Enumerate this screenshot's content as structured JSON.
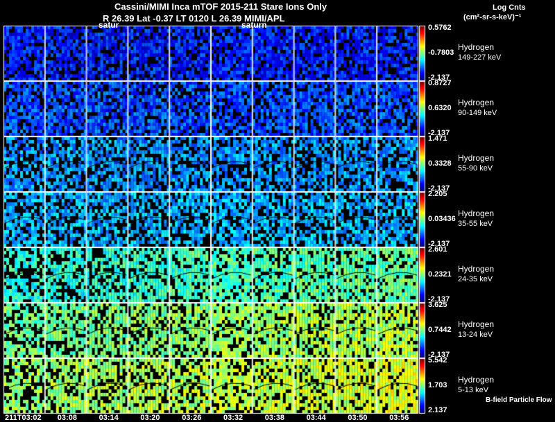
{
  "header": {
    "title": "Cassini/MIMI Inca mTOF  2015-211    Stare    Ions Only",
    "subtitle": "R          26.39 Lat -0.37 LT 0120 L          26.39  MIMI/APL",
    "markers": [
      "satur",
      "saturn"
    ],
    "units_line1": "Log Cnts",
    "units_line2": "(cm²-sr-s-keV)⁻¹"
  },
  "chart_data": {
    "type": "heatmap",
    "title": "Cassini/MIMI Inca mTOF 2015-211 Stare Ions Only",
    "x_tick_labels": [
      "211T03:02",
      "03:08",
      "03:14",
      "03:20",
      "03:26",
      "03:32",
      "03:38",
      "03:44",
      "03:50",
      "03:56"
    ],
    "rows": [
      {
        "species": "Hydrogen",
        "energy": "149-227 keV",
        "cbar_max": "0.5762",
        "cbar_mid": "-0.7803",
        "cbar_min": "-2.137",
        "level": 0.15
      },
      {
        "species": "Hydrogen",
        "energy": "90-149 keV",
        "cbar_max": "0.8727",
        "cbar_mid": "0.6320",
        "cbar_min": "-2.137",
        "level": 0.2
      },
      {
        "species": "Hydrogen",
        "energy": "55-90 keV",
        "cbar_max": "1.471",
        "cbar_mid": "0.3328",
        "cbar_min": "-2.137",
        "level": 0.27
      },
      {
        "species": "Hydrogen",
        "energy": "35-55 keV",
        "cbar_max": "2.205",
        "cbar_mid": "0.03436",
        "cbar_min": "-2.137",
        "level": 0.3
      },
      {
        "species": "Hydrogen",
        "energy": "24-35 keV",
        "cbar_max": "2.601",
        "cbar_mid": "0.2321",
        "cbar_min": "-2.137",
        "level": 0.4
      },
      {
        "species": "Hydrogen",
        "energy": "13-24 keV",
        "cbar_max": "3.625",
        "cbar_mid": "0.7442",
        "cbar_min": "-2.137",
        "level": 0.48
      },
      {
        "species": "Hydrogen",
        "energy": "5-13 keV",
        "cbar_max": "5.542",
        "cbar_mid": "1.703",
        "cbar_min": "2.137",
        "level": 0.52
      }
    ],
    "legend_note": "B-field Particle Flow"
  }
}
